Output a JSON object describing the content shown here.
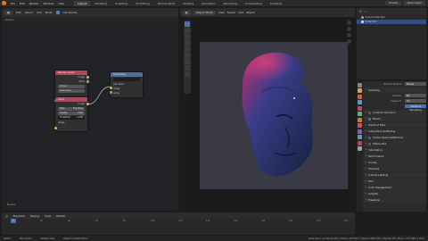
{
  "menu": {
    "items": [
      "File",
      "Edit",
      "Render",
      "Window",
      "Help"
    ],
    "workspaces": [
      {
        "label": "Layout",
        "active": true
      },
      {
        "label": "Modeling",
        "active": false
      },
      {
        "label": "Sculpting",
        "active": false
      },
      {
        "label": "UV Editing",
        "active": false
      },
      {
        "label": "Texture Paint",
        "active": false
      },
      {
        "label": "Shading",
        "active": false
      },
      {
        "label": "Animation",
        "active": false
      },
      {
        "label": "Rendering",
        "active": false
      },
      {
        "label": "Compositing",
        "active": false
      },
      {
        "label": "Scripting",
        "active": false
      }
    ],
    "scene": "Scene",
    "view_layer": "View Layer"
  },
  "node_editor": {
    "header_buttons": [
      "Edit",
      "Select",
      "Add",
      "Node"
    ],
    "use_nodes_label": "Use Nodes",
    "breadcrumb": "Scene",
    "corner_label": "Nodes",
    "nodes": {
      "render_layers": {
        "title": "Render Layers",
        "color": "#b8445a",
        "outputs": [
          "Image",
          "Alpha"
        ],
        "fields": [
          "Scene",
          "View Layer"
        ]
      },
      "glare": {
        "title": "Glare",
        "color": "#b8445a",
        "output": "Image",
        "fields": [
          {
            "label": "Type",
            "value": "Fog Glow"
          },
          {
            "label": "Quality",
            "value": "High"
          },
          {
            "label": "Threshold",
            "value": "1.000"
          }
        ],
        "input": "Image"
      },
      "composite": {
        "title": "Composite",
        "color": "#4d6f9e",
        "fields": [
          "Use Alpha"
        ],
        "inputs": [
          "Image",
          "Alpha"
        ]
      }
    }
  },
  "viewport": {
    "header_buttons": [
      "View",
      "Select",
      "Add",
      "Object"
    ],
    "mode": "Object Mode"
  },
  "outliner": {
    "header": "Scene Collection",
    "rows": [
      {
        "label": "Scene Collection",
        "selected": false
      },
      {
        "label": "Collection",
        "selected": true
      }
    ]
  },
  "properties": {
    "engine_label": "Render Engine",
    "engine_value": "Eevee",
    "sampling": "Sampling",
    "render_samples_label": "Render",
    "render_samples": "64",
    "viewport_samples_label": "Viewport",
    "viewport_samples": "16",
    "denoise_label": "Viewport Denoising",
    "sections": [
      {
        "label": "Ambient Occlusion",
        "toggle": true,
        "on": false
      },
      {
        "label": "Bloom",
        "toggle": true,
        "on": true
      },
      {
        "label": "Depth of Field",
        "toggle": false,
        "on": false
      },
      {
        "label": "Subsurface Scattering",
        "toggle": false,
        "on": false
      },
      {
        "label": "Screen Space Reflections",
        "toggle": true,
        "on": false
      },
      {
        "label": "Motion Blur",
        "toggle": true,
        "on": false
      },
      {
        "label": "Volumetrics",
        "toggle": false,
        "on": false
      },
      {
        "label": "Performance",
        "toggle": false,
        "on": false
      },
      {
        "label": "Curves",
        "toggle": false,
        "on": false
      },
      {
        "label": "Shadows",
        "toggle": false,
        "on": false
      },
      {
        "label": "Indirect Lighting",
        "toggle": false,
        "on": false
      },
      {
        "label": "Film",
        "toggle": false,
        "on": false
      },
      {
        "label": "Color Management",
        "toggle": false,
        "on": false
      },
      {
        "label": "Simplify",
        "toggle": false,
        "on": false
      },
      {
        "label": "Freestyle",
        "toggle": false,
        "on": false
      }
    ],
    "icon_colors": [
      "#888",
      "#e0a040",
      "#d06040",
      "#5a9ad0",
      "#d04050",
      "#60b070",
      "#c08040",
      "#d05060",
      "#8060c0",
      "#50a0c0",
      "#c04060",
      "#a0a0a0"
    ]
  },
  "timeline": {
    "buttons": [
      "Playback",
      "Keying",
      "View",
      "Marker"
    ],
    "current_frame": "1",
    "ticks": [
      "0",
      "20",
      "40",
      "60",
      "80",
      "100",
      "120",
      "140",
      "160",
      "180",
      "200",
      "220",
      "240"
    ]
  },
  "statusbar": {
    "items": [
      "Select",
      "Box Select",
      "Rotate View",
      "Object Context Menu"
    ],
    "stats": "Collection | Armature.003 | Verts:1,234,567 | Faces:2,469,130 | Objects:1/3 | Mem: 1.02 GiB | 2.83.0"
  }
}
